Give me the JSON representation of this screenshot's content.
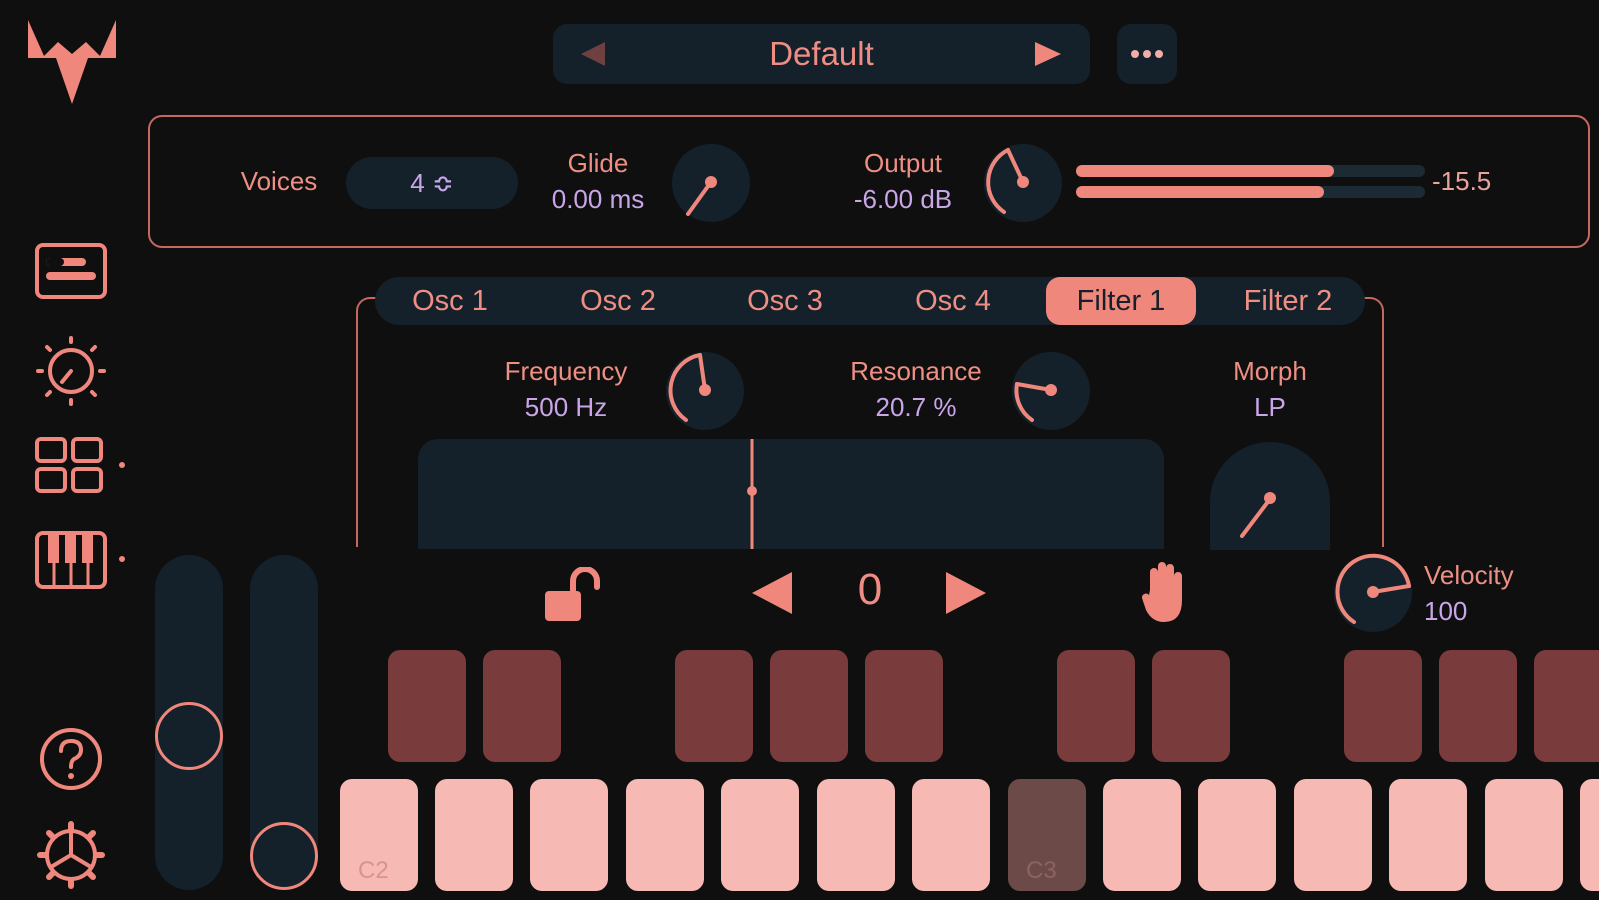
{
  "app": {
    "accent_color": "#f0877c",
    "panel_color": "#14212a",
    "value_color": "#c9a6e8"
  },
  "sidebar": {
    "items": [
      {
        "icon": "logo-icon"
      },
      {
        "icon": "edit-panel-icon"
      },
      {
        "icon": "knob-settings-icon"
      },
      {
        "icon": "grid-icon"
      },
      {
        "icon": "piano-icon"
      },
      {
        "icon": "help-icon"
      },
      {
        "icon": "gear-icon"
      }
    ]
  },
  "preset": {
    "name": "Default",
    "prev_icon": "triangle-left-icon",
    "next_icon": "triangle-right-icon",
    "more_icon": "ellipsis-icon"
  },
  "top_controls": {
    "voices_label": "Voices",
    "voices_value": "4 ≎",
    "glide_label": "Glide",
    "glide_value": "0.00 ms",
    "output_label": "Output",
    "output_value": "-6.00 dB",
    "meter_readout": "-15.5",
    "meter_levels": [
      0.74,
      0.71
    ]
  },
  "tabs": [
    "Osc 1",
    "Osc 2",
    "Osc 3",
    "Osc 4",
    "Filter 1",
    "Filter 2"
  ],
  "active_tab": "Filter 1",
  "filter": {
    "frequency_label": "Frequency",
    "frequency_value": "500 Hz",
    "resonance_label": "Resonance",
    "resonance_value": "20.7 %",
    "morph_label": "Morph",
    "morph_value": "LP"
  },
  "keyboard": {
    "octave_value": "0",
    "velocity_label": "Velocity",
    "velocity_value": "100",
    "key_labels": {
      "c2": "C2",
      "c3": "C3"
    },
    "pitch_bend_level": 0.45,
    "mod_wheel_level": 0.0
  }
}
